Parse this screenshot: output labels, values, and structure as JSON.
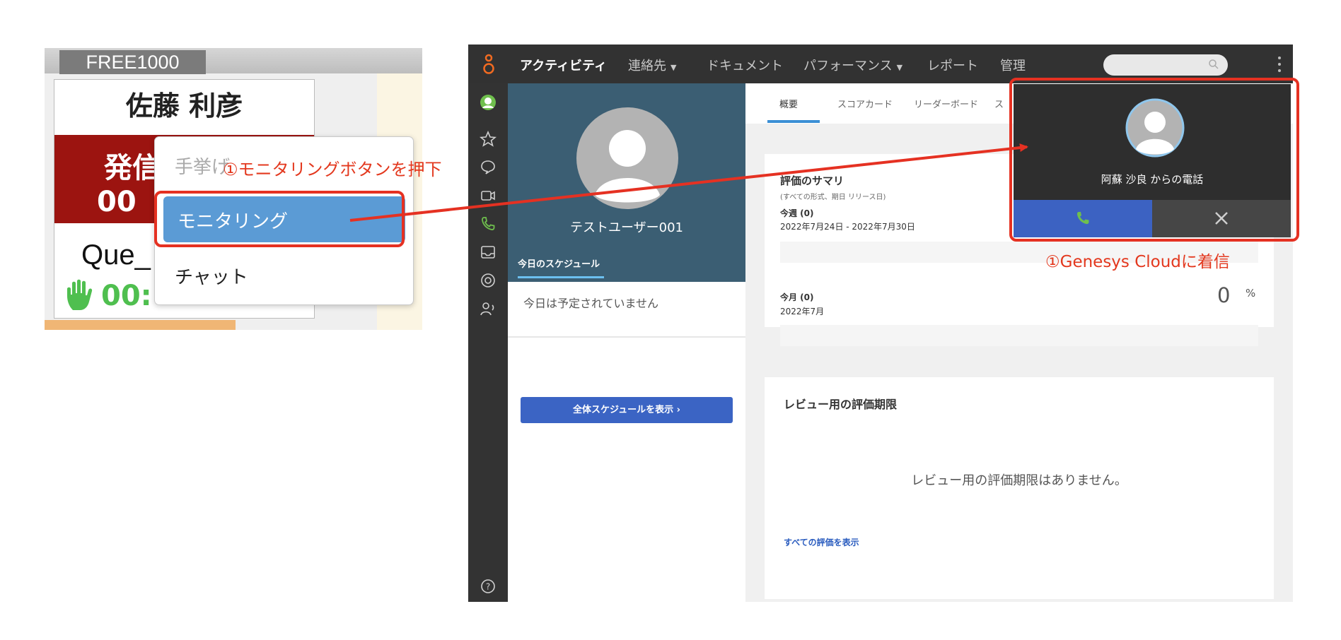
{
  "left_panel": {
    "agent_id": "FREE1000",
    "agent_name": "佐藤 利彦",
    "status_label": "発信",
    "status_time": "00",
    "queue_label": "Que_",
    "hand_time": "00:"
  },
  "context_menu": {
    "items": [
      {
        "label": "手挙げ"
      },
      {
        "label": "モニタリング",
        "selected": true
      },
      {
        "label": "チャット"
      }
    ],
    "annotation": "①モニタリングボタンを押下"
  },
  "app": {
    "nav": {
      "items": [
        {
          "label": "アクティビティ",
          "active": true
        },
        {
          "label": "連絡先"
        },
        {
          "label": "ドキュメント"
        },
        {
          "label": "パフォーマンス"
        },
        {
          "label": "レポート"
        },
        {
          "label": "管理"
        }
      ]
    },
    "sidebar": {
      "icons": [
        "avatar-icon",
        "star-icon",
        "chat-icon",
        "video-icon",
        "phone-icon",
        "inbox-icon",
        "support-icon",
        "people-icon",
        "help-icon"
      ]
    },
    "profile": {
      "user_name": "テストユーザー001",
      "schedule_tab": "今日のスケジュール",
      "no_schedule": "今日は予定されていません",
      "view_schedule_button": "全体スケジュールを表示 ›"
    },
    "tabs": [
      "概要",
      "スコアカード",
      "リーダーボード",
      "ス"
    ],
    "evaluation": {
      "title": "評価のサマリ",
      "subtitle": "(すべての形式、期日 リリース日)",
      "week_label": "今週 (0)",
      "week_range": "2022年7月24日 - 2022年7月30日",
      "month_label": "今月 (0)",
      "month_range": "2022年7月",
      "month_percent": "0",
      "percent_symbol": "%"
    },
    "review": {
      "title": "レビュー用の評価期限",
      "empty_text": "レビュー用の評価期限はありません。",
      "link": "すべての評価を表示"
    },
    "incoming_call": {
      "caller_text": "阿蘇 沙良 からの電話"
    }
  },
  "annotations": {
    "call_annotation": "①Genesys Cloudに着信"
  },
  "colors": {
    "annotation_red": "#e53122",
    "nav_dark": "#323232",
    "profile_blue": "#3b5e73",
    "accept_blue": "#3c62c2",
    "menu_selected": "#5b9bd5",
    "status_red": "#9c1410"
  }
}
